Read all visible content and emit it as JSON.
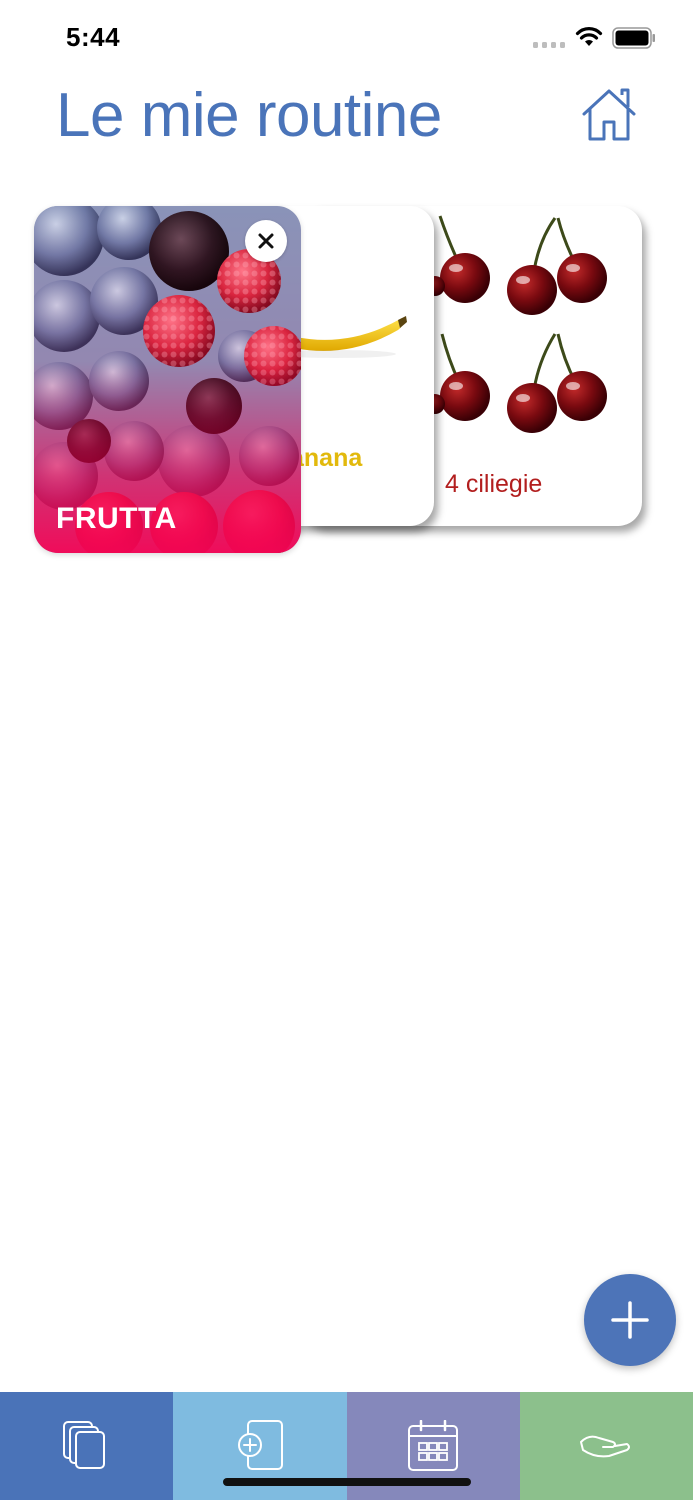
{
  "status_bar": {
    "time": "5:44",
    "icons": [
      "signal-icon",
      "wifi-icon",
      "battery-icon"
    ]
  },
  "header": {
    "title": "Le mie routine",
    "home_icon": "home-icon"
  },
  "routines": [
    {
      "label": "FRUTTA",
      "image": "berries",
      "overlay_color": "#f5005a",
      "label_color": "#ffffff",
      "close_icon": "close-icon"
    },
    {
      "label": "anana",
      "image": "banana",
      "label_color": "#e2b90c"
    },
    {
      "label": "4 ciliegie",
      "image": "cherries",
      "label_color": "#b21e1e"
    }
  ],
  "fab": {
    "icon": "plus-icon",
    "color": "#4d74b8"
  },
  "tab_bar": {
    "tabs": [
      {
        "icon": "cards-icon",
        "color": "#4a73b8"
      },
      {
        "icon": "add-card-icon",
        "color": "#7fbbe0"
      },
      {
        "icon": "calendar-icon",
        "color": "#8588bb"
      },
      {
        "icon": "hand-icon",
        "color": "#8cc08c"
      }
    ]
  },
  "colors": {
    "accent": "#4a74b9"
  }
}
